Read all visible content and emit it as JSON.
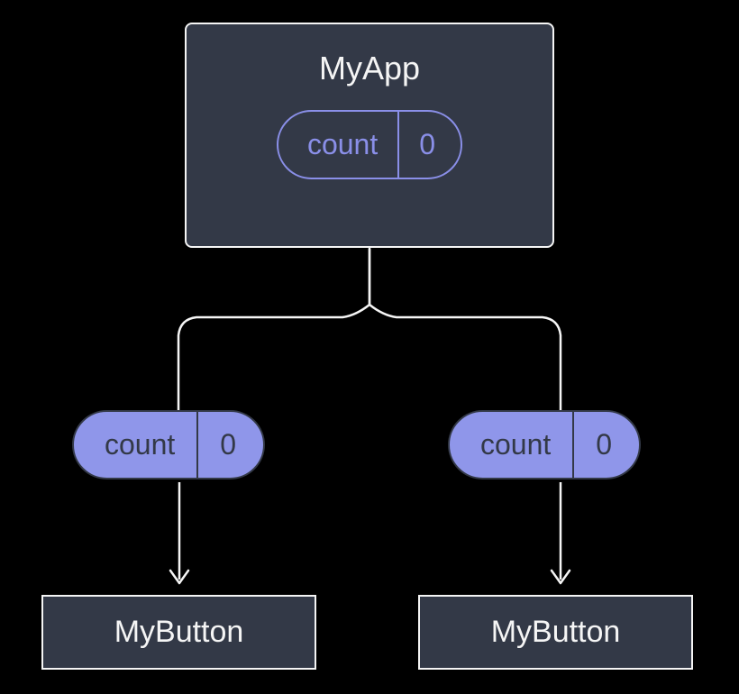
{
  "parent": {
    "title": "MyApp",
    "state_label": "count",
    "state_value": "0"
  },
  "props": {
    "left": {
      "label": "count",
      "value": "0"
    },
    "right": {
      "label": "count",
      "value": "0"
    }
  },
  "children": {
    "left": {
      "title": "MyButton"
    },
    "right": {
      "title": "MyButton"
    }
  },
  "colors": {
    "box_bg": "#333947",
    "box_border": "#f5f5f5",
    "accent": "#8f96ea",
    "accent_outline": "#8a8fe8"
  }
}
